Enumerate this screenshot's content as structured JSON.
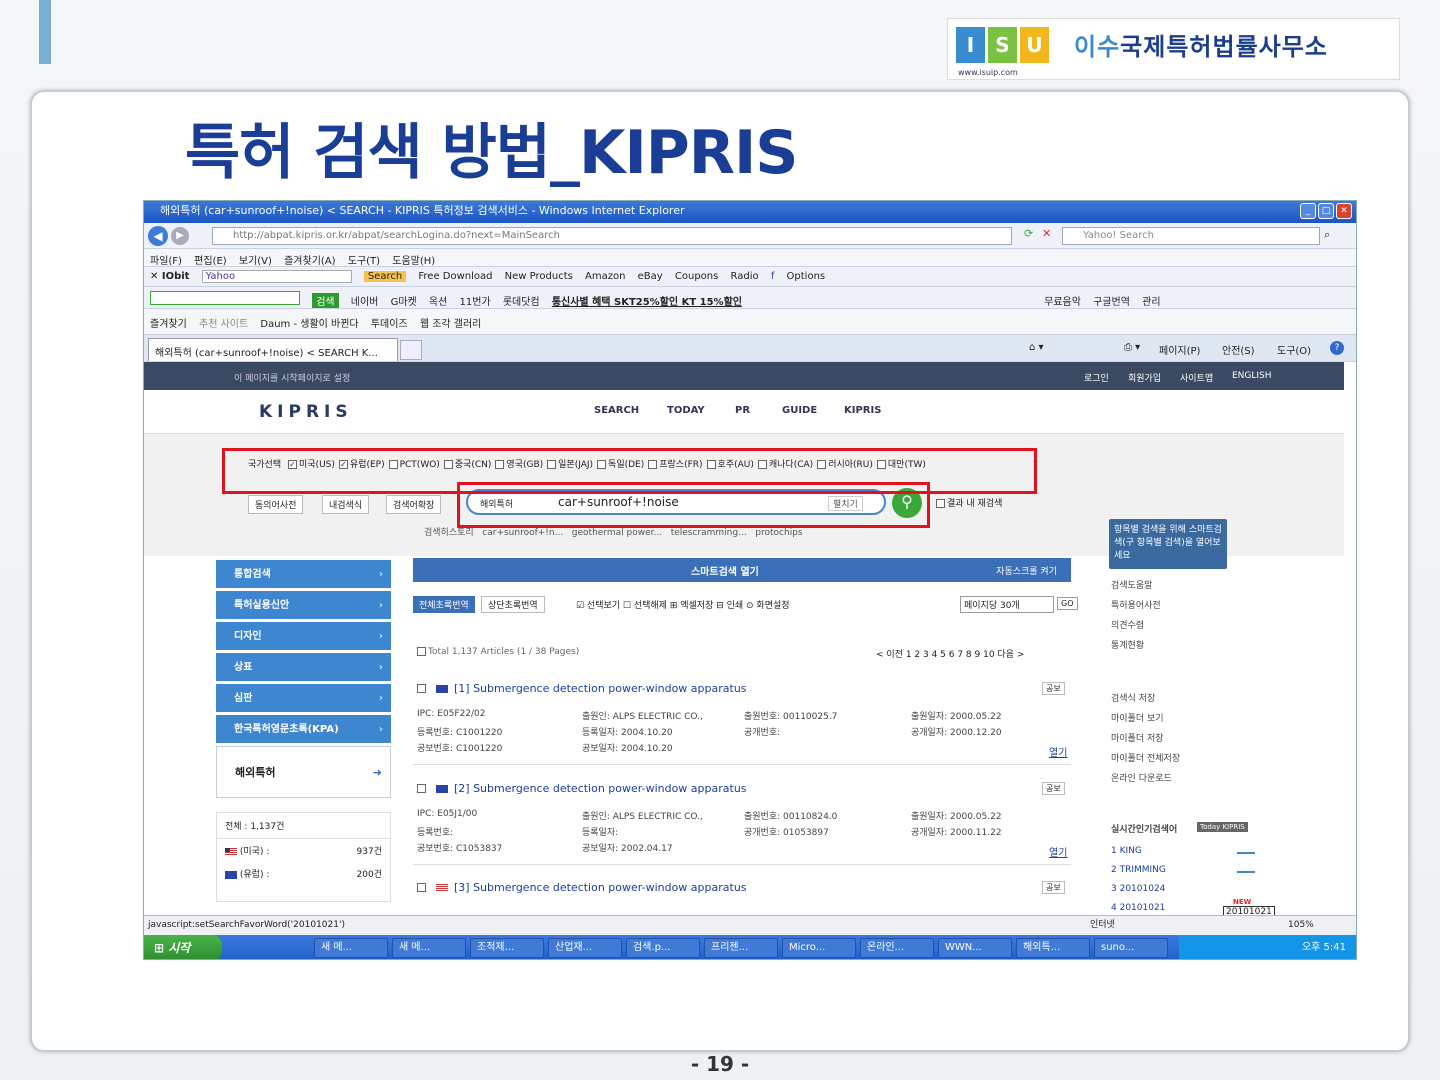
{
  "logo": {
    "letters": [
      "I",
      "S",
      "U"
    ],
    "url": "www.isuip.com",
    "name_first": "이수",
    "name_rest": "국제특허법률사무소"
  },
  "slide": {
    "title": "특허 검색 방법_KIPRIS",
    "page_number": "- 19 -"
  },
  "browser": {
    "title": "해외특허 (car+sunroof+!noise) < SEARCH - KIPRIS 특허정보 검색서비스 - Windows Internet Explorer",
    "address": "http://abpat.kipris.or.kr/abpat/searchLogina.do?next=MainSearch",
    "search_placeholder": "Yahoo! Search",
    "menu": [
      "파일(F)",
      "편집(E)",
      "보기(V)",
      "즐겨찾기(A)",
      "도구(T)",
      "도움말(H)"
    ],
    "toolbar1": [
      "Yahoo",
      "Search",
      "Free Download",
      "New Products",
      "Amazon",
      "eBay",
      "Coupons",
      "Radio",
      "Options"
    ],
    "toolbar2": [
      "검색",
      "네이버",
      "G마켓",
      "옥션",
      "11번가",
      "롯데닷컴",
      "통신사별 혜택 SKT25%할인 KT 15%할인",
      "무료음악",
      "구글번역",
      "관리"
    ],
    "favorites": [
      "즐겨찾기",
      "추천 사이트",
      "Daum - 생활이 바뀐다",
      "투데이즈",
      "웹 조각 갤러리"
    ],
    "tab": "해외특허 (car+sunroof+!noise) < SEARCH K...",
    "cmd": [
      "페이지(P)",
      "안전(S)",
      "도구(O)"
    ],
    "status_url": "javascript:setSearchFavorWord('20101021')",
    "status_zone": "인터넷",
    "zoom": "105%"
  },
  "kipris": {
    "top_links": [
      "로그인",
      "회원가입",
      "사이트맵",
      "ENGLISH"
    ],
    "top_left": "이 페이지를 시작페이지로 설정",
    "logo": "KIPRIS",
    "nav": [
      "SEARCH",
      "TODAY",
      "PR",
      "GUIDE",
      "KIPRIS"
    ],
    "country_label": "국가선택",
    "countries": [
      {
        "label": "미국(US)",
        "checked": true
      },
      {
        "label": "유럽(EP)",
        "checked": true
      },
      {
        "label": "PCT(WO)",
        "checked": false
      },
      {
        "label": "중국(CN)",
        "checked": false
      },
      {
        "label": "영국(GB)",
        "checked": false
      },
      {
        "label": "일본(JAJ)",
        "checked": false
      },
      {
        "label": "독일(DE)",
        "checked": false
      },
      {
        "label": "프랑스(FR)",
        "checked": false
      },
      {
        "label": "호주(AU)",
        "checked": false
      },
      {
        "label": "캐나다(CA)",
        "checked": false
      },
      {
        "label": "러시아(RU)",
        "checked": false
      },
      {
        "label": "대만(TW)",
        "checked": false
      }
    ],
    "helpers": [
      "동의어사전",
      "내검색식",
      "검색어확장"
    ],
    "search_scope": "해외특허",
    "search_value": "car+sunroof+!noise",
    "expand": "펼치기",
    "research": "결과 내 재검색",
    "history_label": "검색히스토리",
    "history": [
      "car+sunroof+!n...",
      "geothermal power...",
      "telescramming...",
      "protochips"
    ],
    "tooltip": "항목별 검색을 위해 스마트검색(구 항목별 검색)을 열어보세요",
    "sidebar": [
      "통합검색",
      "특허실용신안",
      "디자인",
      "상표",
      "심판",
      "한국특허영문초록(KPA)",
      "해외특허"
    ],
    "summary_total": "전체 : 1,137건",
    "summary_rows": [
      {
        "label": "(미국) :",
        "count": "937건"
      },
      {
        "label": "(유럽) :",
        "count": "200건"
      }
    ],
    "smart_bar": "스마트검색 열기",
    "smart_right": "자동스크롤 켜기",
    "tabs": [
      "전체초록번역",
      "상단초록번역"
    ],
    "view_opts": "☑ 선택보기 ☐ 선택해제 ⊞ 엑셀저장 ⊟ 인쇄 ⊙ 화면설정",
    "per_page": "페이지당 30개",
    "go": "GO",
    "total_text": "Total 1,137 Articles (1 / 38 Pages)",
    "pager": "< 이전 1 2 3 4 5 6 7 8 9 10 다음 >",
    "results": [
      {
        "title": "[1] Submergence detection power-window apparatus",
        "ipc": "IPC: E05F22/02",
        "reg_no": "등록번호: C1001220",
        "pub_no": "공보번호: C1001220",
        "applicant": "출원인: ALPS ELECTRIC CO.,",
        "reg_date": "등록일자: 2004.10.20",
        "pub_date": "공보일자: 2004.10.20",
        "app_no": "출원번호: 00110025.7",
        "open_no": "공개번호:",
        "app_date": "출원일자: 2000.05.22",
        "open_date": "공개일자: 2000.12.20",
        "more": "열기"
      },
      {
        "title": "[2] Submergence detection power-window apparatus",
        "ipc": "IPC: E05J1/00",
        "reg_no": "등록번호:",
        "pub_no": "공보번호: C1053837",
        "applicant": "출원인: ALPS ELECTRIC CO.,",
        "reg_date": "등록일자:",
        "pub_date": "공보일자: 2002.04.17",
        "app_no": "출원번호: 00110824.0",
        "open_no": "공개번호: 01053897",
        "app_date": "출원일자: 2000.05.22",
        "open_date": "공개일자: 2000.11.22",
        "more": "열기"
      },
      {
        "title": "[3] Submergence detection power-window apparatus"
      }
    ],
    "badge": "공보",
    "right_links1": [
      "검색도움말",
      "특허용어사전",
      "의견수렴",
      "통계현황"
    ],
    "right_links2": [
      "검색식 저장",
      "마이폴더 보기",
      "마이폴더 저장",
      "마이폴더 전체저장",
      "온라인 다운로드"
    ],
    "realtime_label": "실시간인기검색어",
    "realtime_badge": "Today KIPRIS",
    "realtime": [
      "KING",
      "TRIMMING",
      "20101024",
      "20101021"
    ],
    "realtime_new": "NEW",
    "realtime_tip": "20101021"
  },
  "taskbar": {
    "start": "시작",
    "tasks": [
      "새 메...",
      "새 메...",
      "조적제...",
      "산업재...",
      "검색.p...",
      "프리젠...",
      "Micro...",
      "온라인...",
      "WWN...",
      "해외특...",
      "suno..."
    ],
    "clock": "오후 5:41"
  }
}
